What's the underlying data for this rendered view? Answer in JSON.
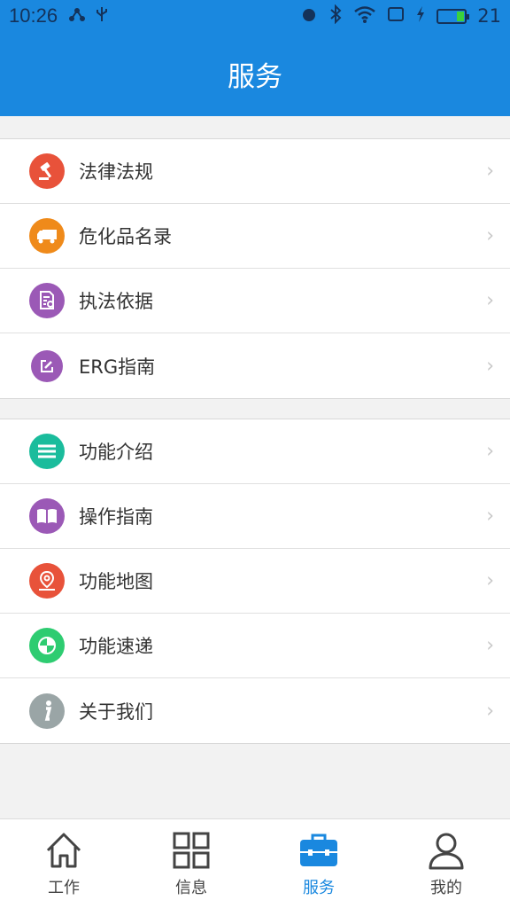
{
  "statusbar": {
    "time": "10:26",
    "battery_level": "21"
  },
  "header": {
    "title": "服务"
  },
  "group1": [
    {
      "label": "法律法规",
      "icon": "gavel-icon",
      "color": "#e8523a"
    },
    {
      "label": "危化品名录",
      "icon": "truck-icon",
      "color": "#ef8a1a"
    },
    {
      "label": "执法依据",
      "icon": "document-search-icon",
      "color": "#9b59b6"
    },
    {
      "label": "ERG指南",
      "icon": "edit-icon",
      "color": "#9b59b6"
    }
  ],
  "group2": [
    {
      "label": "功能介绍",
      "icon": "list-icon",
      "color": "#1abc9c"
    },
    {
      "label": "操作指南",
      "icon": "book-icon",
      "color": "#9b59b6"
    },
    {
      "label": "功能地图",
      "icon": "map-pin-icon",
      "color": "#e8523a"
    },
    {
      "label": "功能速递",
      "icon": "pie-icon",
      "color": "#2ecc71"
    },
    {
      "label": "关于我们",
      "icon": "info-icon",
      "color": "#9aa5a6"
    }
  ],
  "tabs": [
    {
      "label": "工作",
      "icon": "home-icon",
      "active": false
    },
    {
      "label": "信息",
      "icon": "grid-icon",
      "active": false
    },
    {
      "label": "服务",
      "icon": "toolbox-icon",
      "active": true
    },
    {
      "label": "我的",
      "icon": "person-icon",
      "active": false
    }
  ],
  "chevron": "›",
  "colors": {
    "primary": "#1a88df"
  }
}
